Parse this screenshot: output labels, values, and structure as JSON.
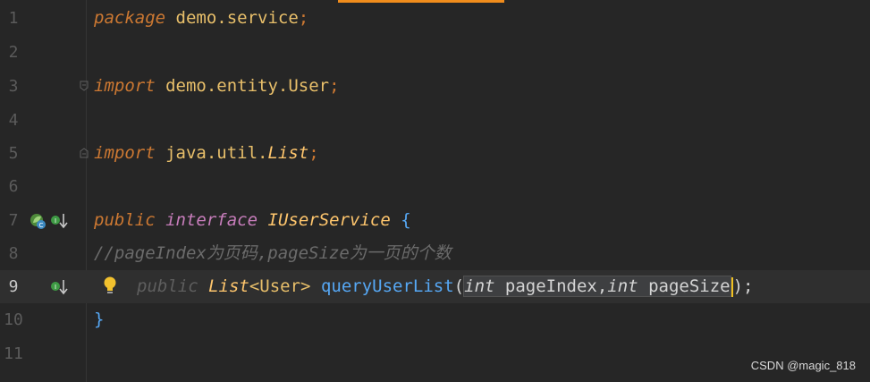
{
  "editor": {
    "lines": [
      {
        "number": "1",
        "tokens": [
          "package",
          " demo.service",
          ";"
        ]
      },
      {
        "number": "2",
        "tokens": []
      },
      {
        "number": "3",
        "tokens": [
          "import",
          " demo.entity.User",
          ";"
        ]
      },
      {
        "number": "4",
        "tokens": []
      },
      {
        "number": "5",
        "tokens": [
          "import",
          " java.util.",
          "List",
          ";"
        ]
      },
      {
        "number": "6",
        "tokens": []
      },
      {
        "number": "7",
        "tokens": [
          "public",
          " ",
          "interface",
          " ",
          "IUserService",
          " {"
        ]
      },
      {
        "number": "8",
        "tokens": [
          "//pageIndex为页码,pageSize为一页的个数"
        ]
      },
      {
        "number": "9",
        "tokens": [
          "public",
          " ",
          "List",
          "<User>",
          " ",
          "queryUserList",
          "(",
          "int",
          " pageIndex,",
          "int",
          " pageSize",
          ");"
        ]
      },
      {
        "number": "10",
        "tokens": [
          "}"
        ]
      },
      {
        "number": "11",
        "tokens": []
      }
    ]
  },
  "gutter": {
    "icons": {
      "line7_spring": "spring-bean-icon",
      "line7_implemented": "implemented-down-icon",
      "line9_implemented": "implemented-down-icon",
      "line9_bulb": "lightbulb-icon",
      "fold": "fold-icon"
    }
  },
  "watermark": "CSDN @magic_818",
  "colors": {
    "background": "#262626",
    "keyword": "#cc7832",
    "interface_keyword": "#c77dbb",
    "type": "#ffc66d",
    "method": "#56a8f5",
    "comment": "#6b6b6b",
    "caret": "#f0c020",
    "tab_accent": "#f08c1c"
  }
}
